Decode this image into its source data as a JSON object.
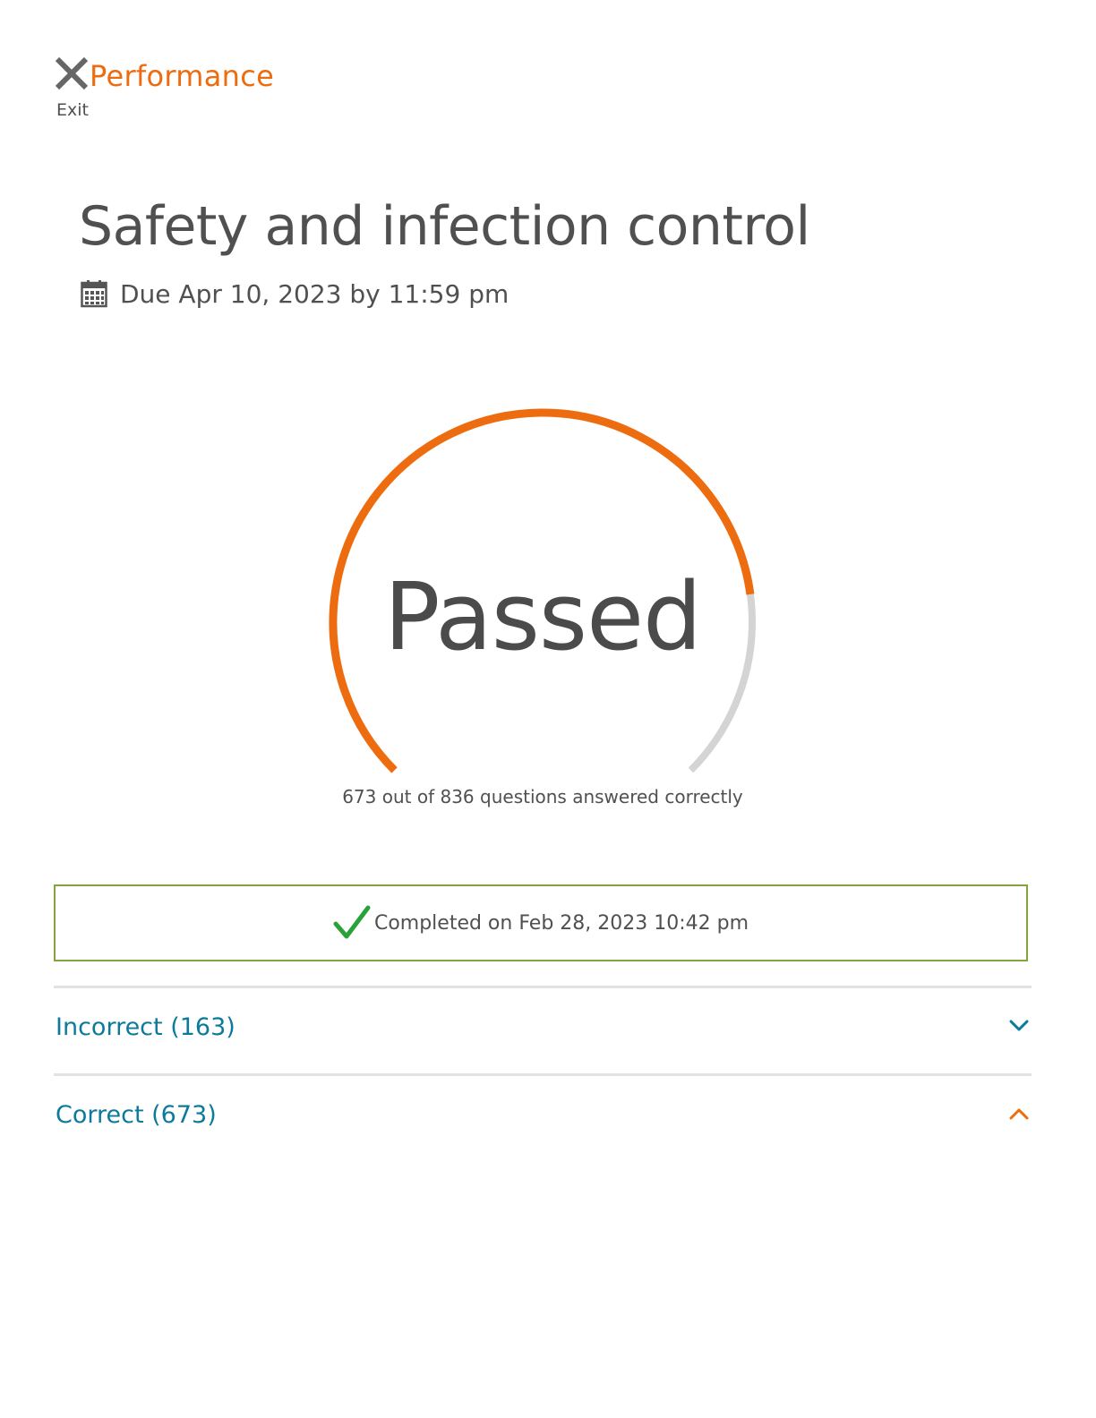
{
  "header": {
    "app_title": "Performance",
    "exit_label": "Exit"
  },
  "assignment": {
    "title": "Safety and infection control",
    "due_text": "Due Apr 10, 2023 by 11:59 pm"
  },
  "result": {
    "status": "Passed",
    "correct": 673,
    "total": 836,
    "score_text": "673 out of 836 questions answered correctly",
    "completed_text": "Completed on Feb 28, 2023 10:42 pm"
  },
  "sections": [
    {
      "label": "Incorrect (163)",
      "expanded": false
    },
    {
      "label": "Correct (673)",
      "expanded": true
    }
  ],
  "colors": {
    "brand_orange": "#ee6c10",
    "gauge_track": "#d4d4d4",
    "link_blue": "#0c7a9a",
    "success_green": "#2aa23a",
    "completed_border": "#82a53d"
  },
  "icons": {
    "exit": "close-icon",
    "due": "calendar-icon",
    "completed": "checkmark-icon",
    "collapsed": "chevron-down-icon",
    "expanded": "chevron-up-icon"
  }
}
